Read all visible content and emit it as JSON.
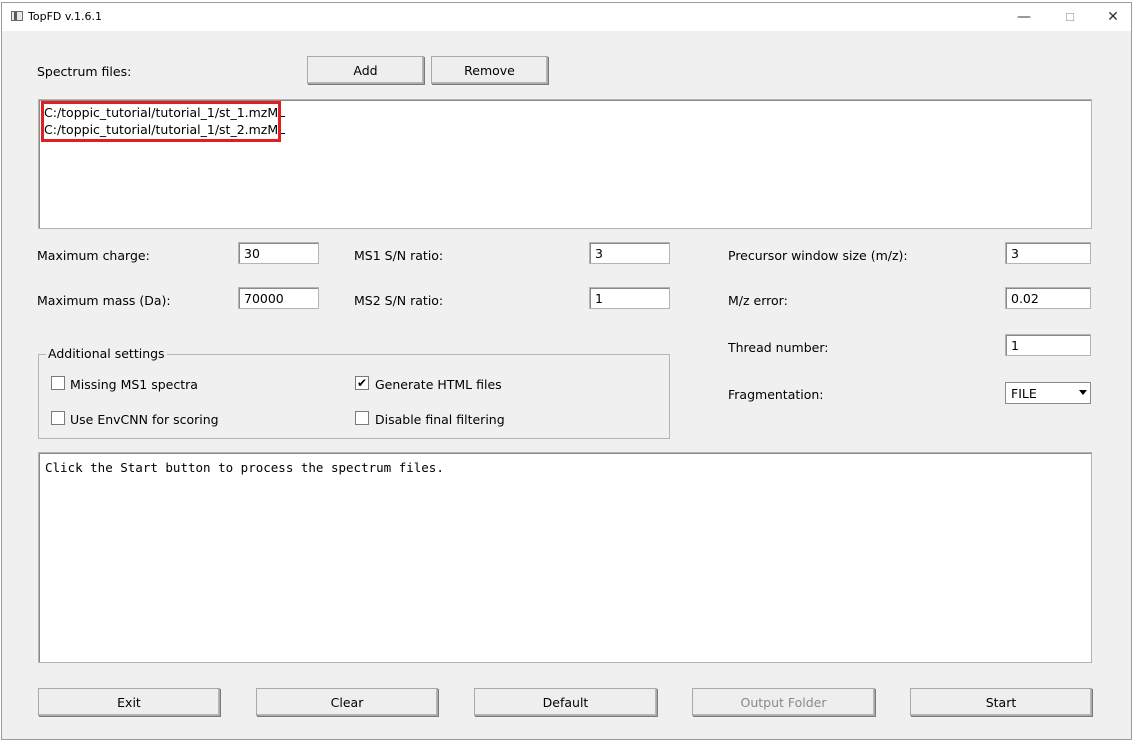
{
  "window": {
    "title": "TopFD v.1.6.1",
    "minimize": "—",
    "maximize": "☐",
    "close": "✕"
  },
  "spectrum": {
    "label": "Spectrum files:",
    "add_label": "Add",
    "remove_label": "Remove",
    "files": [
      "C:/toppic_tutorial/tutorial_1/st_1.mzML",
      "C:/toppic_tutorial/tutorial_1/st_2.mzML"
    ]
  },
  "params": {
    "max_charge": {
      "label": "Maximum charge:",
      "value": "30"
    },
    "max_mass": {
      "label": "Maximum mass (Da):",
      "value": "70000"
    },
    "ms1_sn": {
      "label": "MS1 S/N ratio:",
      "value": "3"
    },
    "ms2_sn": {
      "label": "MS2 S/N ratio:",
      "value": "1"
    },
    "precursor_window": {
      "label": "Precursor window size (m/z):",
      "value": "3"
    },
    "mz_error": {
      "label": "M/z error:",
      "value": "0.02"
    },
    "thread_number": {
      "label": "Thread number:",
      "value": "1"
    },
    "fragmentation": {
      "label": "Fragmentation:",
      "value": "FILE"
    }
  },
  "additional": {
    "title": "Additional settings",
    "missing_ms1": {
      "label": "Missing MS1 spectra",
      "checked": false
    },
    "generate_html": {
      "label": "Generate HTML files",
      "checked": true
    },
    "use_envcnn": {
      "label": "Use EnvCNN for scoring",
      "checked": false
    },
    "disable_filtering": {
      "label": "Disable final filtering",
      "checked": false
    },
    "check_mark": "✔"
  },
  "log": {
    "text": "Click the Start button to process the spectrum files."
  },
  "buttons": {
    "exit": "Exit",
    "clear": "Clear",
    "default": "Default",
    "output_folder": "Output Folder",
    "start": "Start"
  }
}
